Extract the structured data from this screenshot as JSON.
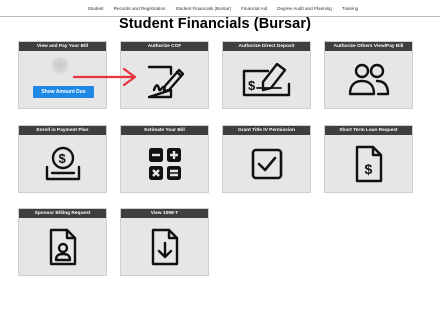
{
  "nav": {
    "items": [
      "Student",
      "Records and Registration",
      "Student Financials (Bursar)",
      "Financial Aid",
      "Degree Audit and Planning",
      "Training"
    ]
  },
  "page": {
    "title": "Student Financials (Bursar)"
  },
  "tiles": {
    "view_pay_bill": {
      "title": "View and Pay Your Bill",
      "button": "Show Amount Due"
    },
    "authorize_cof": {
      "title": "Authorize COF",
      "icon": "signature-document-icon"
    },
    "authorize_direct_deposit": {
      "title": "Authorize Direct Deposit",
      "icon": "check-pen-icon"
    },
    "authorize_others": {
      "title": "Authorize Others View/Pay Bill",
      "icon": "users-icon"
    },
    "payment_plan": {
      "title": "Enroll in Payment Plan",
      "icon": "coin-slot-icon"
    },
    "estimate_bill": {
      "title": "Estimate Your Bill",
      "icon": "calculator-icon"
    },
    "grant_title_iv": {
      "title": "Grant Title IV Permission",
      "icon": "checkbox-icon"
    },
    "short_term_loan": {
      "title": "Short Term Loan Request",
      "icon": "dollar-document-icon"
    },
    "sponsor_billing": {
      "title": "Sponsor Billing Request",
      "icon": "person-document-icon"
    },
    "view_1098t": {
      "title": "View 1098-T",
      "icon": "download-document-icon"
    }
  },
  "colors": {
    "tile_header": "#3f3f3f",
    "tile_bg": "#e6e6e6",
    "button": "#1e88e5",
    "arrow": "#e8323c"
  }
}
